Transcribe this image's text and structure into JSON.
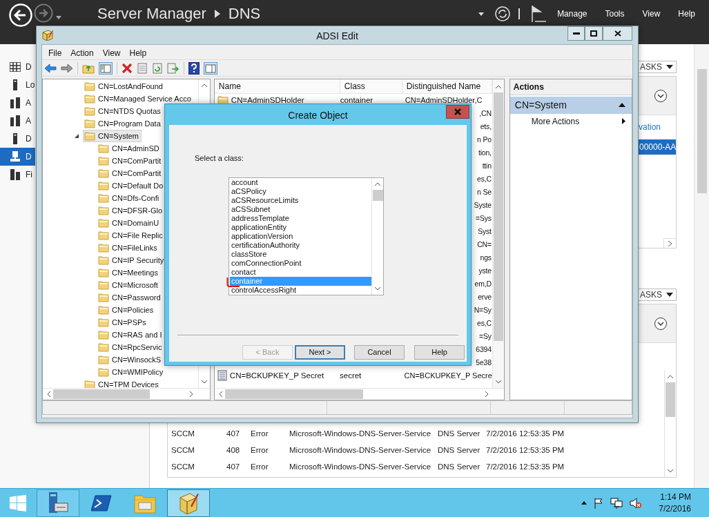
{
  "server_manager": {
    "breadcrumb": [
      "Server Manager",
      "DNS"
    ],
    "menu": [
      "Manage",
      "Tools",
      "View",
      "Help"
    ],
    "sidebar": [
      {
        "kind": "dashboard",
        "label": "D",
        "selected": false
      },
      {
        "kind": "server",
        "label": "Lo",
        "selected": false
      },
      {
        "kind": "servers",
        "label": "A",
        "selected": false
      },
      {
        "kind": "servers",
        "label": "A",
        "selected": false
      },
      {
        "kind": "server",
        "label": "D",
        "selected": false
      },
      {
        "kind": "dns",
        "label": "D",
        "selected": true
      },
      {
        "kind": "storage",
        "label": "Fi",
        "selected": false
      }
    ],
    "tiles": [
      {
        "tasks": "ASKS",
        "link": "vation",
        "row": "00000-AA"
      },
      {
        "tasks": "ASKS"
      }
    ],
    "events": [
      {
        "server": "SCCM",
        "id": "407",
        "severity": "Error",
        "source": "Microsoft-Windows-DNS-Server-Service",
        "log": "DNS Server",
        "date": "7/2/2016 12:53:35 PM"
      },
      {
        "server": "SCCM",
        "id": "408",
        "severity": "Error",
        "source": "Microsoft-Windows-DNS-Server-Service",
        "log": "DNS Server",
        "date": "7/2/2016 12:53:35 PM"
      },
      {
        "server": "SCCM",
        "id": "407",
        "severity": "Error",
        "source": "Microsoft-Windows-DNS-Server-Service",
        "log": "DNS Server",
        "date": "7/2/2016 12:53:35 PM"
      }
    ]
  },
  "adsi_edit": {
    "title": "ADSI Edit",
    "menu": [
      "File",
      "Action",
      "View",
      "Help"
    ],
    "tree": [
      {
        "label": "CN=LostAndFound",
        "selected": false
      },
      {
        "label": "CN=Managed Service Acco",
        "selected": false
      },
      {
        "label": "CN=NTDS Quotas",
        "selected": false
      },
      {
        "label": "CN=Program Data",
        "selected": false
      },
      {
        "label": "CN=System",
        "selected": true,
        "expanded": true,
        "children": [
          {
            "label": "CN=AdminSD",
            "selected": false
          },
          {
            "label": "CN=ComPartit",
            "selected": false
          },
          {
            "label": "CN=ComPartit",
            "selected": false
          },
          {
            "label": "CN=Default Do",
            "selected": false
          },
          {
            "label": "CN=Dfs-Confi",
            "selected": false
          },
          {
            "label": "CN=DFSR-Glo",
            "selected": false
          },
          {
            "label": "CN=DomainU",
            "selected": false
          },
          {
            "label": "CN=File Replic",
            "selected": false
          },
          {
            "label": "CN=FileLinks",
            "selected": false
          },
          {
            "label": "CN=IP Security",
            "selected": false
          },
          {
            "label": "CN=Meetings",
            "selected": false
          },
          {
            "label": "CN=Microsoft",
            "selected": false
          },
          {
            "label": "CN=Password",
            "selected": false
          },
          {
            "label": "CN=Policies",
            "selected": false
          },
          {
            "label": "CN=PSPs",
            "selected": false
          },
          {
            "label": "CN=RAS and I",
            "selected": false
          },
          {
            "label": "CN=RpcServic",
            "selected": false
          },
          {
            "label": "CN=WinsockS",
            "selected": false
          },
          {
            "label": "CN=WMIPolicy",
            "selected": false
          }
        ]
      },
      {
        "label": "CN=TPM Devices",
        "selected": false
      }
    ],
    "list": {
      "columns": [
        "Name",
        "Class",
        "Distinguished Name"
      ],
      "rows": [
        {
          "kind": "full",
          "name": "CN=AdminSDHolder",
          "class": "container",
          "dn": "CN=AdminSDHolder,C"
        },
        {
          "kind": "fragment",
          "dn": ",CN"
        },
        {
          "kind": "fragment",
          "dn": "ets,"
        },
        {
          "kind": "fragment",
          "dn": "n Po"
        },
        {
          "kind": "fragment",
          "dn": "tion,"
        },
        {
          "kind": "fragment",
          "dn": "ttin"
        },
        {
          "kind": "fragment",
          "dn": "es,C"
        },
        {
          "kind": "fragment",
          "dn": "n Se"
        },
        {
          "kind": "fragment",
          "dn": "Syste"
        },
        {
          "kind": "fragment",
          "dn": "=Sys"
        },
        {
          "kind": "fragment",
          "dn": "Syst"
        },
        {
          "kind": "fragment",
          "dn": "CN="
        },
        {
          "kind": "fragment",
          "dn": "ngs"
        },
        {
          "kind": "fragment",
          "dn": "yste"
        },
        {
          "kind": "fragment",
          "dn": "em,D"
        },
        {
          "kind": "fragment",
          "dn": "erve"
        },
        {
          "kind": "fragment",
          "dn": "N=Sy"
        },
        {
          "kind": "fragment",
          "dn": "es,C"
        },
        {
          "kind": "fragment",
          "dn": "=Sy"
        },
        {
          "kind": "fragment",
          "dn": "6394"
        },
        {
          "kind": "fragment",
          "dn": "5e38"
        },
        {
          "kind": "full",
          "name": "CN=BCKUPKEY_P Secret",
          "class": "secret",
          "dn": "CN=BCKUPKEY_P Secre"
        }
      ]
    },
    "actions": {
      "header": "Actions",
      "section": "CN=System",
      "items": [
        "More Actions"
      ]
    }
  },
  "dialog": {
    "title": "Create Object",
    "prompt": "Select a class:",
    "classes": [
      {
        "label": "account",
        "selected": false
      },
      {
        "label": "aCSPolicy",
        "selected": false
      },
      {
        "label": "aCSResourceLimits",
        "selected": false
      },
      {
        "label": "aCSSubnet",
        "selected": false
      },
      {
        "label": "addressTemplate",
        "selected": false
      },
      {
        "label": "applicationEntity",
        "selected": false
      },
      {
        "label": "applicationVersion",
        "selected": false
      },
      {
        "label": "certificationAuthority",
        "selected": false
      },
      {
        "label": "classStore",
        "selected": false
      },
      {
        "label": "comConnectionPoint",
        "selected": false
      },
      {
        "label": "contact",
        "selected": false
      },
      {
        "label": "container",
        "selected": true
      },
      {
        "label": "controlAccessRight",
        "selected": false
      }
    ],
    "buttons": [
      {
        "label": "< Back",
        "disabled": true,
        "default": false
      },
      {
        "label": "Next >",
        "disabled": false,
        "default": true
      },
      {
        "label": "Cancel",
        "disabled": false,
        "default": false
      },
      {
        "label": "Help",
        "disabled": false,
        "default": false
      }
    ]
  },
  "taskbar": {
    "apps": [
      {
        "kind": "start",
        "selected": false
      },
      {
        "kind": "server-manager",
        "selected": false
      },
      {
        "kind": "powershell",
        "selected": false
      },
      {
        "kind": "explorer",
        "selected": false
      },
      {
        "kind": "adsi",
        "selected": true
      }
    ],
    "time": "1:14 PM",
    "date": "7/2/2016"
  }
}
